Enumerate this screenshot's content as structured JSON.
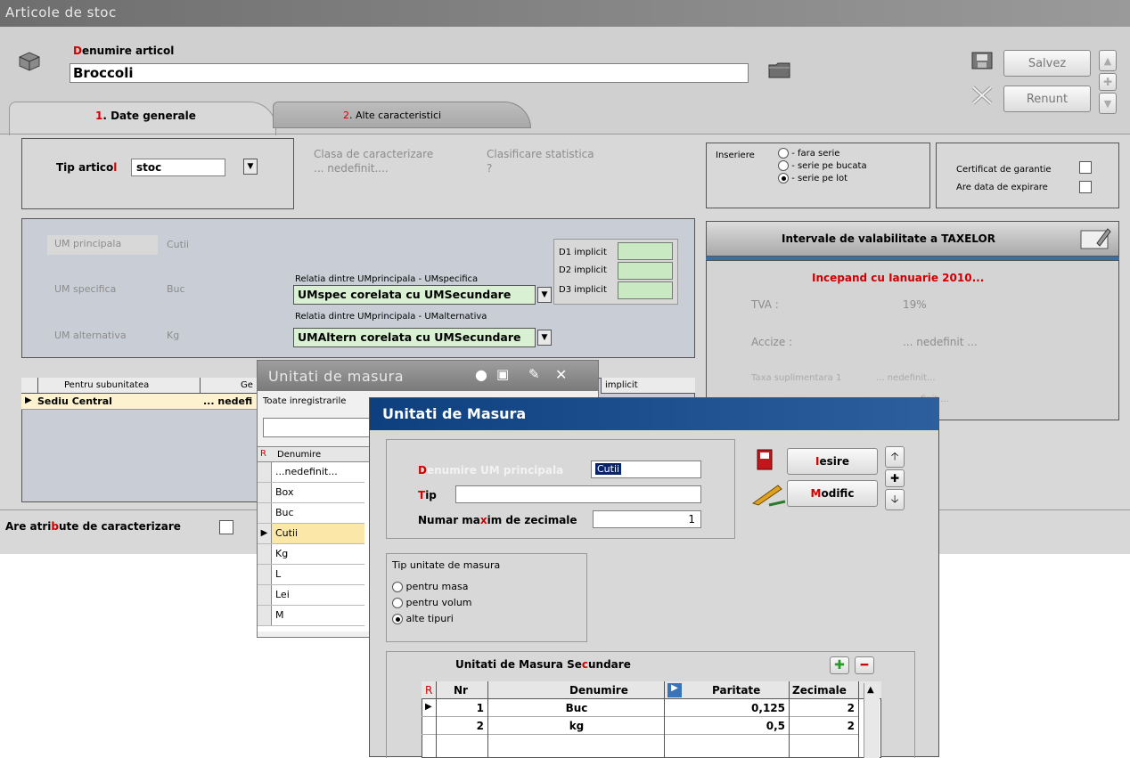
{
  "window": {
    "title": "Articole de stoc"
  },
  "header": {
    "name_label": "Denumire articol",
    "name_label_first": "D",
    "name_label_rest": "enumire articol",
    "name_value": "Broccoli",
    "save_label": "Salvez",
    "cancel_label": "Renunt"
  },
  "tabs": [
    {
      "num": "1",
      "label": ". Date generale"
    },
    {
      "num": "2",
      "label": ". Alte caracteristici"
    }
  ],
  "tip_articol": {
    "label": "Tip artico",
    "label_red": "l",
    "value": "stoc",
    "clasa_label": "Clasa de caracterizare",
    "clasa_value": "... nedefinit....",
    "clasificare_label": "Clasificare statistica",
    "clasificare_value": "?"
  },
  "inserare": {
    "label": "Inseriere",
    "options": [
      "- fara serie",
      "- serie pe bucata",
      "- serie pe lot"
    ],
    "selected": 2
  },
  "garantie": {
    "certificat_label": "Certificat de garantie",
    "expirare_label": "Are data de expirare"
  },
  "um": {
    "principala_label": "UM principala",
    "principala_value": "Cutii",
    "specifica_label": "UM specifica",
    "specifica_value": "Buc",
    "alternativa_label": "UM alternativa",
    "alternativa_value": "Kg",
    "relatia1_label": "Relatia dintre UMprincipala - UMspecifica",
    "relatia1_value": "UMspec corelata cu UMSecundare",
    "relatia2_label": "Relatia dintre UMprincipala - UMalternativa",
    "relatia2_value": "UMAltern corelata cu UMSecundare",
    "d1": "D1 implicit",
    "d2": "D2 implicit",
    "d3": "D3 implicit"
  },
  "taxe": {
    "title": "Intervale de valabilitate a TAXELOR",
    "period": "Incepand cu Ianuarie 2010...",
    "tva_label": "TVA :",
    "tva_value": "19%",
    "accize_label": "Accize :",
    "accize_value": "... nedefinit ...",
    "taxa_label": "Taxa suplimentara 1",
    "taxa_value": "... nedefinit...",
    "row4_value": "finit ..."
  },
  "subunit_table": {
    "col1": "Pentru subunitatea",
    "col2": "Ge",
    "col_implicit": "implicit",
    "row_name": "Sediu Central",
    "row_value": "... nedefi"
  },
  "atribute": {
    "label_a": "Are atri",
    "label_b": "b",
    "label_c": "ute de caracterizare"
  },
  "popup_list": {
    "title": "Unitati de masura",
    "filter": "Toate inregistrarile",
    "header_r": "R",
    "header": "Denumire",
    "items": [
      "...nedefinit...",
      "Box",
      "Buc",
      "Cutii",
      "Kg",
      "L",
      "Lei",
      "M"
    ],
    "selected": 3
  },
  "dialog": {
    "title": "Unitati de Masura",
    "denumire_first": "D",
    "denumire_rest": "enumire UM principala",
    "denumire_value": "Cutii",
    "tip_first": "T",
    "tip_rest": "ip",
    "tip_value": "",
    "zecimale_a": "Numar ma",
    "zecimale_b": "x",
    "zecimale_c": "im de zecimale",
    "zecimale_value": "1",
    "iesire_first": "I",
    "iesire_rest": "esire",
    "modific_first": "M",
    "modific_rest": "odific",
    "tip_um_label": "Tip unitate de masura",
    "tip_um_options": [
      "pentru masa",
      "pentru volum",
      "alte tipuri"
    ],
    "tip_um_selected": 2,
    "secundare_a": "Unitati de Masura Se",
    "secundare_b": "c",
    "secundare_c": "undare",
    "table": {
      "col_r": "R",
      "col_nr": "Nr",
      "col_den": "Denumire",
      "col_par": "Paritate",
      "col_zec": "Zecimale",
      "rows": [
        {
          "nr": "1",
          "den": "Buc",
          "par": "0,125",
          "zec": "2"
        },
        {
          "nr": "2",
          "den": "kg",
          "par": "0,5",
          "zec": "2"
        }
      ]
    }
  }
}
